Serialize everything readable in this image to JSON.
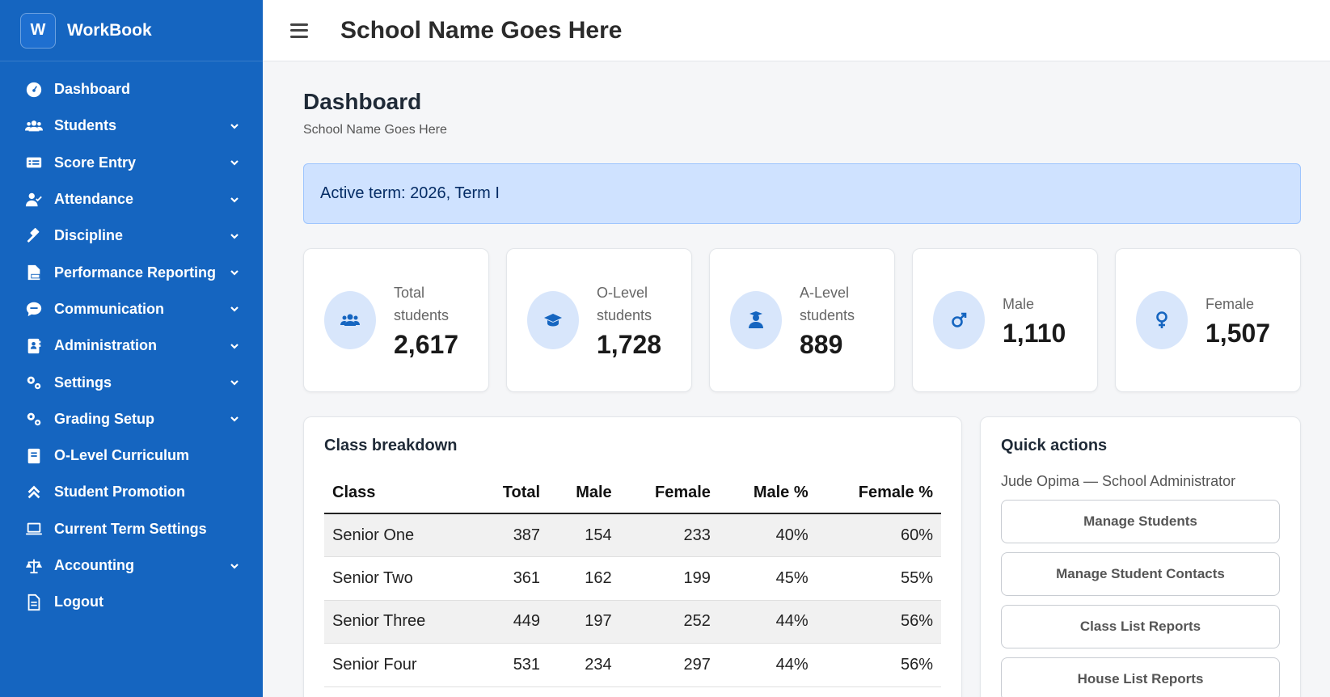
{
  "brand": {
    "logo_letter": "W",
    "name": "WorkBook"
  },
  "sidebar": {
    "items": [
      {
        "label": "Dashboard",
        "icon": "gauge-icon",
        "has_children": false
      },
      {
        "label": "Students",
        "icon": "users-icon",
        "has_children": true
      },
      {
        "label": "Score Entry",
        "icon": "id-card-icon",
        "has_children": true
      },
      {
        "label": "Attendance",
        "icon": "user-check-icon",
        "has_children": true
      },
      {
        "label": "Discipline",
        "icon": "gavel-icon",
        "has_children": true
      },
      {
        "label": "Performance Reporting",
        "icon": "file-pdf-icon",
        "has_children": true
      },
      {
        "label": "Communication",
        "icon": "sms-bubble-icon",
        "has_children": true
      },
      {
        "label": "Administration",
        "icon": "address-book-icon",
        "has_children": true
      },
      {
        "label": "Settings",
        "icon": "cogs-icon",
        "has_children": true
      },
      {
        "label": "Grading Setup",
        "icon": "cogs-icon",
        "has_children": true
      },
      {
        "label": "O-Level Curriculum",
        "icon": "book-icon",
        "has_children": false
      },
      {
        "label": "Student Promotion",
        "icon": "angles-up-icon",
        "has_children": false
      },
      {
        "label": "Current Term Settings",
        "icon": "laptop-icon",
        "has_children": false
      },
      {
        "label": "Accounting",
        "icon": "scale-icon",
        "has_children": true
      },
      {
        "label": "Logout",
        "icon": "file-icon",
        "has_children": false
      }
    ]
  },
  "topbar": {
    "title": "School Name Goes Here"
  },
  "page": {
    "title": "Dashboard",
    "subtitle": "School Name Goes Here"
  },
  "alert": {
    "text": "Active term: 2026, Term I"
  },
  "stats": [
    {
      "label_line1": "Total",
      "label_line2": "students",
      "value": "2,617",
      "icon": "users-icon"
    },
    {
      "label_line1": "O-Level",
      "label_line2": "students",
      "value": "1,728",
      "icon": "graduation-cap-icon"
    },
    {
      "label_line1": "A-Level",
      "label_line2": "students",
      "value": "889",
      "icon": "user-graduate-icon"
    },
    {
      "label_line1": "Male",
      "label_line2": "",
      "value": "1,110",
      "icon": "mars-icon"
    },
    {
      "label_line1": "Female",
      "label_line2": "",
      "value": "1,507",
      "icon": "venus-icon"
    }
  ],
  "class_breakdown": {
    "title": "Class breakdown",
    "columns": [
      "Class",
      "Total",
      "Male",
      "Female",
      "Male %",
      "Female %"
    ],
    "rows": [
      [
        "Senior One",
        "387",
        "154",
        "233",
        "40%",
        "60%"
      ],
      [
        "Senior Two",
        "361",
        "162",
        "199",
        "45%",
        "55%"
      ],
      [
        "Senior Three",
        "449",
        "197",
        "252",
        "44%",
        "56%"
      ],
      [
        "Senior Four",
        "531",
        "234",
        "297",
        "44%",
        "56%"
      ]
    ]
  },
  "quick_actions": {
    "title": "Quick actions",
    "user": "Jude Opima — School Administrator",
    "buttons": [
      "Manage Students",
      "Manage Student Contacts",
      "Class List Reports",
      "House List Reports"
    ]
  },
  "colors": {
    "sidebar": "#1565c0",
    "accent": "#1565c0",
    "alert_bg": "#cfe2ff",
    "icon_bg": "#d8e6fb"
  }
}
